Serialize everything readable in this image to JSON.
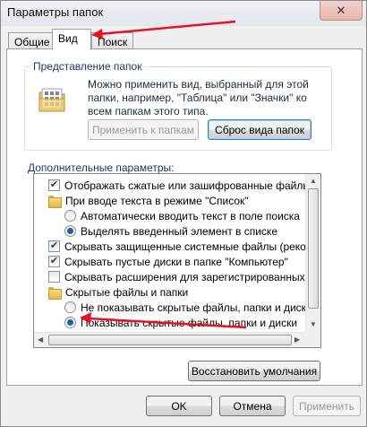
{
  "window": {
    "title": "Параметры папок",
    "close_glyph": "✕"
  },
  "tabs": [
    {
      "label": "Общие"
    },
    {
      "label": "Вид"
    },
    {
      "label": "Поиск"
    }
  ],
  "folder_views": {
    "group_label": "Представление папок",
    "description": "Можно применить вид, выбранный для этой папки, например, \"Таблица\" или \"Значки\" ко всем папкам этого типа.",
    "apply_button": "Применить к папкам",
    "reset_button": "Сброс вида папок"
  },
  "advanced": {
    "label": "Дополнительные параметры:",
    "items": [
      {
        "type": "checkbox",
        "checked": true,
        "label": "Отображать сжатые или зашифрованные файлы NTFS"
      },
      {
        "type": "folder",
        "label": "При вводе текста в режиме \"Список\""
      },
      {
        "type": "radio",
        "selected": false,
        "label": "Автоматически вводить текст в поле поиска"
      },
      {
        "type": "radio",
        "selected": true,
        "label": "Выделять введенный элемент в списке"
      },
      {
        "type": "checkbox",
        "checked": true,
        "label": "Скрывать защищенные системные файлы (рекомендуется)"
      },
      {
        "type": "checkbox",
        "checked": true,
        "label": "Скрывать пустые диски в папке \"Компьютер\""
      },
      {
        "type": "checkbox",
        "checked": false,
        "label": "Скрывать расширения для зарегистрированных типов файлов"
      },
      {
        "type": "folder",
        "label": "Скрытые файлы и папки"
      },
      {
        "type": "radio",
        "selected": false,
        "label": "Не показывать скрытые файлы, папки и диски"
      },
      {
        "type": "radio",
        "selected": true,
        "label": "Показывать скрытые файлы, папки и диски"
      }
    ],
    "restore_button": "Восстановить умолчания"
  },
  "dialog_buttons": {
    "ok": "OK",
    "cancel": "Отмена",
    "apply": "Применить"
  },
  "colors": {
    "annotation_arrow": "#e8141d",
    "accent": "#1e3a6e"
  }
}
